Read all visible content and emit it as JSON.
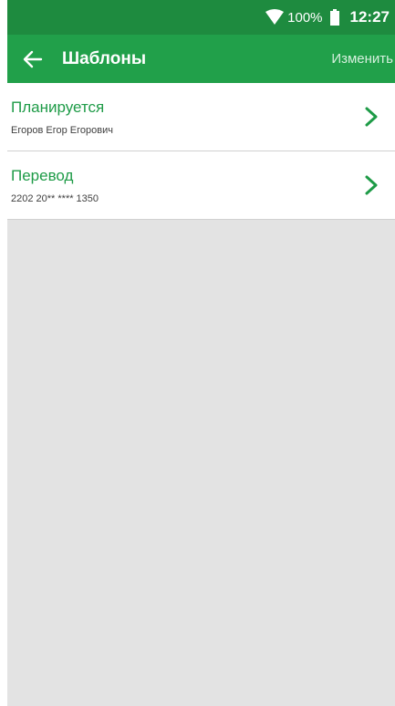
{
  "status_bar": {
    "battery_percent": "100%",
    "time": "12:27"
  },
  "header": {
    "title": "Шаблоны",
    "edit_label": "Изменить"
  },
  "templates": [
    {
      "name": "Планируется",
      "subtitle": "Егоров Егор Егорович"
    },
    {
      "name": "Перевод",
      "subtitle": "2202 20** **** 1350"
    }
  ],
  "colors": {
    "status_bar": "#1e8b3f",
    "app_bar": "#21a04a",
    "accent_text": "#1e9b47",
    "background": "#e3e3e3"
  }
}
